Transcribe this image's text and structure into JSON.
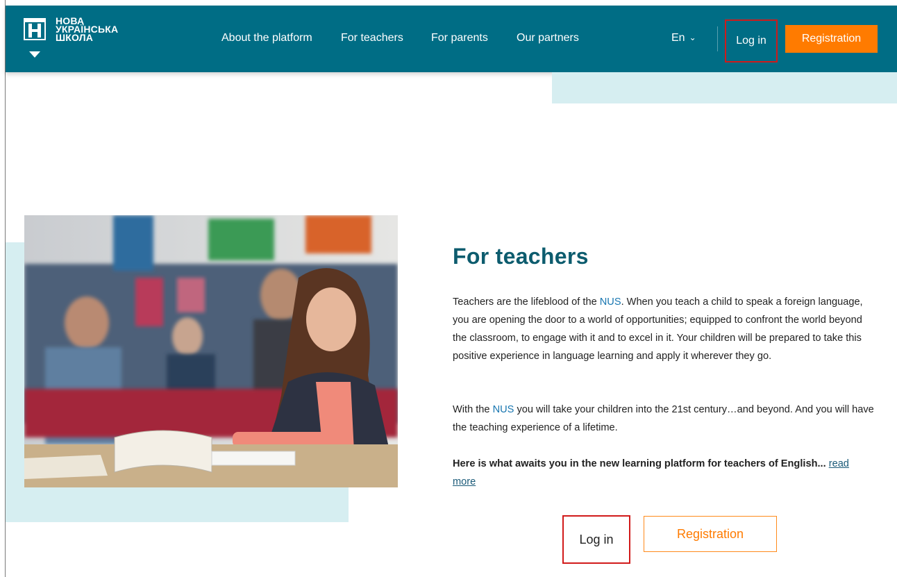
{
  "header": {
    "logo_lines": [
      "НОВА",
      "УКРАЇНСЬКА",
      "ШКОЛА"
    ],
    "nav": [
      {
        "label": "About the platform"
      },
      {
        "label": "For teachers"
      },
      {
        "label": "For parents"
      },
      {
        "label": "Our partners"
      }
    ],
    "language": "En",
    "login_label": "Log in",
    "register_label": "Registration"
  },
  "main": {
    "title": "For teachers",
    "para1_pre": "Teachers are the lifeblood of the ",
    "nus": "NUS",
    "para1_post": ". When you teach a child to speak a foreign language, you are opening the door to a world of opportunities; equipped to confront the world beyond the classroom, to engage with it and to excel in it. Your children will be prepared to take this positive experience in language learning and apply it wherever they go.",
    "para2_pre": "With the ",
    "para2_post": " you will take your children into the 21st century…and beyond. And you will have the teaching experience of a lifetime.",
    "para3": "Here is what awaits you in the new learning platform for teachers of English...",
    "read_more": "read more",
    "login_label": "Log in",
    "register_label": "Registration"
  },
  "colors": {
    "nav_bg": "#006d85",
    "accent_orange": "#ff7b00",
    "title_teal": "#0d5c6e",
    "light_teal": "#d6eef1",
    "highlight_red": "#d11a1a"
  }
}
